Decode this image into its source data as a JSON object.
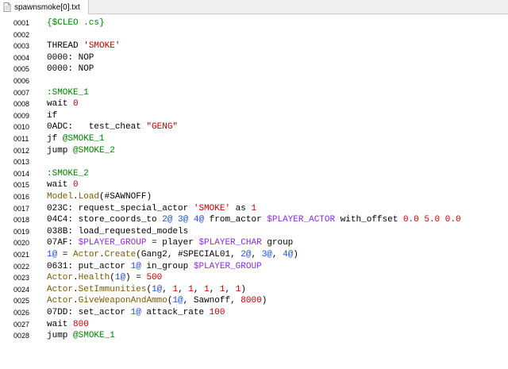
{
  "tab": {
    "title": "spawnsmoke[0].txt",
    "icon": "text-file-icon"
  },
  "lines": [
    {
      "n": "0001",
      "tokens": [
        {
          "t": "{$CLEO .cs}",
          "c": "g"
        }
      ]
    },
    {
      "n": "0002",
      "tokens": []
    },
    {
      "n": "0003",
      "tokens": [
        {
          "t": "THREAD ",
          "c": "k"
        },
        {
          "t": "'SMOKE'",
          "c": "r"
        }
      ]
    },
    {
      "n": "0004",
      "tokens": [
        {
          "t": "0000: NOP",
          "c": "k"
        }
      ]
    },
    {
      "n": "0005",
      "tokens": [
        {
          "t": "0000: NOP",
          "c": "k"
        }
      ]
    },
    {
      "n": "0006",
      "tokens": []
    },
    {
      "n": "0007",
      "tokens": [
        {
          "t": ":SMOKE_1",
          "c": "g"
        }
      ]
    },
    {
      "n": "0008",
      "tokens": [
        {
          "t": "wait ",
          "c": "k"
        },
        {
          "t": "0",
          "c": "n"
        }
      ]
    },
    {
      "n": "0009",
      "tokens": [
        {
          "t": "if",
          "c": "k"
        }
      ]
    },
    {
      "n": "0010",
      "tokens": [
        {
          "t": "0ADC:   test_cheat ",
          "c": "k"
        },
        {
          "t": "\"GENG\"",
          "c": "r"
        }
      ]
    },
    {
      "n": "0011",
      "tokens": [
        {
          "t": "jf ",
          "c": "k"
        },
        {
          "t": "@SMOKE_1",
          "c": "g"
        }
      ]
    },
    {
      "n": "0012",
      "tokens": [
        {
          "t": "jump ",
          "c": "k"
        },
        {
          "t": "@SMOKE_2",
          "c": "g"
        }
      ]
    },
    {
      "n": "0013",
      "tokens": []
    },
    {
      "n": "0014",
      "tokens": [
        {
          "t": ":SMOKE_2",
          "c": "g"
        }
      ]
    },
    {
      "n": "0015",
      "tokens": [
        {
          "t": "wait ",
          "c": "k"
        },
        {
          "t": "0",
          "c": "n"
        }
      ]
    },
    {
      "n": "0016",
      "tokens": [
        {
          "t": "Model",
          "c": "o"
        },
        {
          "t": ".",
          "c": "k"
        },
        {
          "t": "Load",
          "c": "o"
        },
        {
          "t": "(#SAWNOFF)",
          "c": "k"
        }
      ]
    },
    {
      "n": "0017",
      "tokens": [
        {
          "t": "023C: request_special_actor ",
          "c": "k"
        },
        {
          "t": "'SMOKE'",
          "c": "r"
        },
        {
          "t": " as ",
          "c": "k"
        },
        {
          "t": "1",
          "c": "n"
        }
      ]
    },
    {
      "n": "0018",
      "tokens": [
        {
          "t": "04C4: store_coords_to ",
          "c": "k"
        },
        {
          "t": "2@",
          "c": "b"
        },
        {
          "t": " ",
          "c": "k"
        },
        {
          "t": "3@",
          "c": "b"
        },
        {
          "t": " ",
          "c": "k"
        },
        {
          "t": "4@",
          "c": "b"
        },
        {
          "t": " from_actor ",
          "c": "k"
        },
        {
          "t": "$PLAYER_ACTOR",
          "c": "m"
        },
        {
          "t": " with_offset ",
          "c": "k"
        },
        {
          "t": "0.0 5.0 0.0",
          "c": "n"
        }
      ]
    },
    {
      "n": "0019",
      "tokens": [
        {
          "t": "038B: load_requested_models",
          "c": "k"
        }
      ]
    },
    {
      "n": "0020",
      "tokens": [
        {
          "t": "07AF: ",
          "c": "k"
        },
        {
          "t": "$PLAYER_GROUP",
          "c": "m"
        },
        {
          "t": " = player ",
          "c": "k"
        },
        {
          "t": "$PLAYER_CHAR",
          "c": "m"
        },
        {
          "t": " group",
          "c": "k"
        }
      ]
    },
    {
      "n": "0021",
      "tokens": [
        {
          "t": "1@",
          "c": "b"
        },
        {
          "t": " = ",
          "c": "k"
        },
        {
          "t": "Actor",
          "c": "o"
        },
        {
          "t": ".",
          "c": "k"
        },
        {
          "t": "Create",
          "c": "o"
        },
        {
          "t": "(Gang2, ",
          "c": "k"
        },
        {
          "t": "#SPECIAL01",
          "c": "k"
        },
        {
          "t": ", ",
          "c": "k"
        },
        {
          "t": "2@",
          "c": "b"
        },
        {
          "t": ", ",
          "c": "k"
        },
        {
          "t": "3@",
          "c": "b"
        },
        {
          "t": ", ",
          "c": "k"
        },
        {
          "t": "4@",
          "c": "b"
        },
        {
          "t": ")",
          "c": "k"
        }
      ]
    },
    {
      "n": "0022",
      "tokens": [
        {
          "t": "0631: put_actor ",
          "c": "k"
        },
        {
          "t": "1@",
          "c": "b"
        },
        {
          "t": " in_group ",
          "c": "k"
        },
        {
          "t": "$PLAYER_GROUP",
          "c": "m"
        }
      ]
    },
    {
      "n": "0023",
      "tokens": [
        {
          "t": "Actor",
          "c": "o"
        },
        {
          "t": ".",
          "c": "k"
        },
        {
          "t": "Health",
          "c": "o"
        },
        {
          "t": "(",
          "c": "k"
        },
        {
          "t": "1@",
          "c": "b"
        },
        {
          "t": ") = ",
          "c": "k"
        },
        {
          "t": "500",
          "c": "n"
        }
      ]
    },
    {
      "n": "0024",
      "tokens": [
        {
          "t": "Actor",
          "c": "o"
        },
        {
          "t": ".",
          "c": "k"
        },
        {
          "t": "SetImmunities",
          "c": "o"
        },
        {
          "t": "(",
          "c": "k"
        },
        {
          "t": "1@",
          "c": "b"
        },
        {
          "t": ", ",
          "c": "k"
        },
        {
          "t": "1",
          "c": "n"
        },
        {
          "t": ", ",
          "c": "k"
        },
        {
          "t": "1",
          "c": "n"
        },
        {
          "t": ", ",
          "c": "k"
        },
        {
          "t": "1",
          "c": "n"
        },
        {
          "t": ", ",
          "c": "k"
        },
        {
          "t": "1",
          "c": "n"
        },
        {
          "t": ", ",
          "c": "k"
        },
        {
          "t": "1",
          "c": "n"
        },
        {
          "t": ")",
          "c": "k"
        }
      ]
    },
    {
      "n": "0025",
      "tokens": [
        {
          "t": "Actor",
          "c": "o"
        },
        {
          "t": ".",
          "c": "k"
        },
        {
          "t": "GiveWeaponAndAmmo",
          "c": "o"
        },
        {
          "t": "(",
          "c": "k"
        },
        {
          "t": "1@",
          "c": "b"
        },
        {
          "t": ", Sawnoff, ",
          "c": "k"
        },
        {
          "t": "8000",
          "c": "n"
        },
        {
          "t": ")",
          "c": "k"
        }
      ]
    },
    {
      "n": "0026",
      "tokens": [
        {
          "t": "07DD: set_actor ",
          "c": "k"
        },
        {
          "t": "1@",
          "c": "b"
        },
        {
          "t": " attack_rate ",
          "c": "k"
        },
        {
          "t": "100",
          "c": "n"
        }
      ]
    },
    {
      "n": "0027",
      "tokens": [
        {
          "t": "wait ",
          "c": "k"
        },
        {
          "t": "800",
          "c": "n"
        }
      ]
    },
    {
      "n": "0028",
      "tokens": [
        {
          "t": "jump ",
          "c": "k"
        },
        {
          "t": "@SMOKE_1",
          "c": "g"
        }
      ]
    }
  ]
}
